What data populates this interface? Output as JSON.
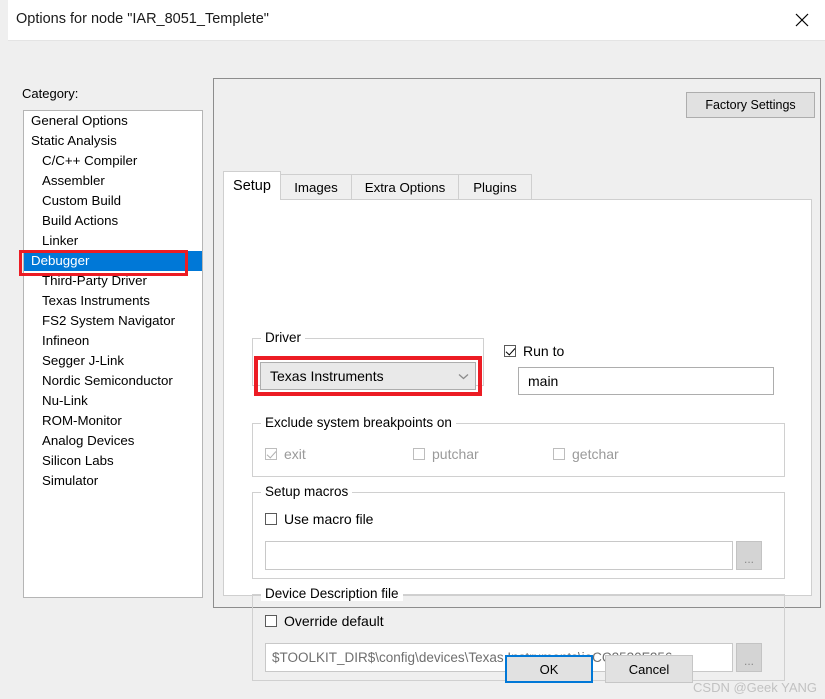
{
  "window": {
    "title": "Options for node \"IAR_8051_Templete\"",
    "close_icon": "close-icon"
  },
  "category": {
    "label": "Category:",
    "items": [
      {
        "label": "General Options",
        "indent": false,
        "selected": false
      },
      {
        "label": "Static Analysis",
        "indent": false,
        "selected": false
      },
      {
        "label": "C/C++ Compiler",
        "indent": true,
        "selected": false
      },
      {
        "label": "Assembler",
        "indent": true,
        "selected": false
      },
      {
        "label": "Custom Build",
        "indent": true,
        "selected": false
      },
      {
        "label": "Build Actions",
        "indent": true,
        "selected": false
      },
      {
        "label": "Linker",
        "indent": true,
        "selected": false
      },
      {
        "label": "Debugger",
        "indent": false,
        "selected": true
      },
      {
        "label": "Third-Party Driver",
        "indent": true,
        "selected": false
      },
      {
        "label": "Texas Instruments",
        "indent": true,
        "selected": false
      },
      {
        "label": "FS2 System Navigator",
        "indent": true,
        "selected": false
      },
      {
        "label": "Infineon",
        "indent": true,
        "selected": false
      },
      {
        "label": "Segger J-Link",
        "indent": true,
        "selected": false
      },
      {
        "label": "Nordic Semiconductor",
        "indent": true,
        "selected": false
      },
      {
        "label": "Nu-Link",
        "indent": true,
        "selected": false
      },
      {
        "label": "ROM-Monitor",
        "indent": true,
        "selected": false
      },
      {
        "label": "Analog Devices",
        "indent": true,
        "selected": false
      },
      {
        "label": "Silicon Labs",
        "indent": true,
        "selected": false
      },
      {
        "label": "Simulator",
        "indent": true,
        "selected": false
      }
    ]
  },
  "panel": {
    "factory_settings_label": "Factory Settings",
    "tabs": [
      {
        "label": "Setup",
        "active": true
      },
      {
        "label": "Images",
        "active": false
      },
      {
        "label": "Extra Options",
        "active": false
      },
      {
        "label": "Plugins",
        "active": false
      }
    ]
  },
  "setup": {
    "driver": {
      "group_title": "Driver",
      "selected_value": "Texas Instruments",
      "chevron_icon": "chevron-down-icon"
    },
    "run_to": {
      "label": "Run to",
      "checked": true,
      "value": "main",
      "placeholder": ""
    },
    "exclude_breakpoints": {
      "group_title": "Exclude system breakpoints on",
      "items": [
        {
          "label": "exit",
          "checked": true,
          "disabled": true
        },
        {
          "label": "putchar",
          "checked": false,
          "disabled": true
        },
        {
          "label": "getchar",
          "checked": false,
          "disabled": true
        }
      ]
    },
    "setup_macros": {
      "group_title": "Setup macros",
      "use_macro_file_label": "Use macro file",
      "use_macro_file_checked": false,
      "file_value": "",
      "file_placeholder": "",
      "browse_label": "..."
    },
    "device_description": {
      "group_title": "Device Description file",
      "override_default_label": "Override default",
      "override_default_checked": false,
      "path_value": "$TOOLKIT_DIR$\\config\\devices\\Texas Instruments\\ioCC2530F256",
      "browse_label": "..."
    }
  },
  "footer": {
    "ok_label": "OK",
    "cancel_label": "Cancel",
    "watermark": "CSDN @Geek YANG"
  },
  "colors": {
    "selection_blue": "#0078d7",
    "annotation_red": "#ec1c24",
    "dialog_bg": "#efefef",
    "content_bg": "#ffffff"
  }
}
